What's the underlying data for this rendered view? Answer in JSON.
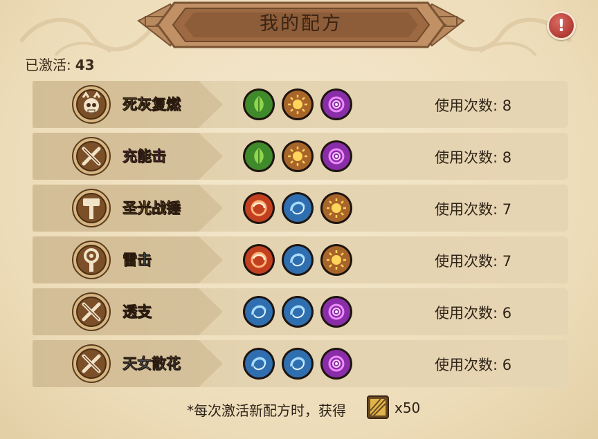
{
  "title": "我的配方",
  "activated": {
    "label": "已激活:",
    "count": "43"
  },
  "recipes": [
    {
      "name": "死灰复燃",
      "name_color": "#a8d86a",
      "badge": "skull-icon",
      "elements": [
        "leaf",
        "sun",
        "void"
      ],
      "uses": "使用次数: 8"
    },
    {
      "name": "充能击",
      "name_color": "#c46be0",
      "badge": "crossed-swords-icon",
      "elements": [
        "leaf",
        "sun",
        "void"
      ],
      "uses": "使用次数: 8"
    },
    {
      "name": "圣光战锤",
      "name_color": "#f0d56a",
      "badge": "hammer-icon",
      "elements": [
        "fire",
        "water",
        "sun"
      ],
      "uses": "使用次数: 7"
    },
    {
      "name": "雷击",
      "name_color": "#5fb4ea",
      "badge": "swirl-staff-icon",
      "elements": [
        "fire",
        "water",
        "sun"
      ],
      "uses": "使用次数: 7"
    },
    {
      "name": "透支",
      "name_color": "#2a2a2a",
      "badge": "crossed-swords-icon",
      "elements": [
        "water",
        "water",
        "void"
      ],
      "uses": "使用次数: 6"
    },
    {
      "name": "天女散花",
      "name_color": "#6fc2ee",
      "badge": "crossed-swords-icon",
      "elements": [
        "water",
        "water",
        "void"
      ],
      "uses": "使用次数: 6"
    }
  ],
  "element_colors": {
    "leaf": "#3f8a2a",
    "sun": "#a8652a",
    "void": "#8a2da8",
    "fire": "#c2401f",
    "water": "#2f6fb0"
  },
  "footer": {
    "text": "*每次激活新配方时，获得",
    "quantity": "x50",
    "icon": "gold-ticket-icon"
  }
}
